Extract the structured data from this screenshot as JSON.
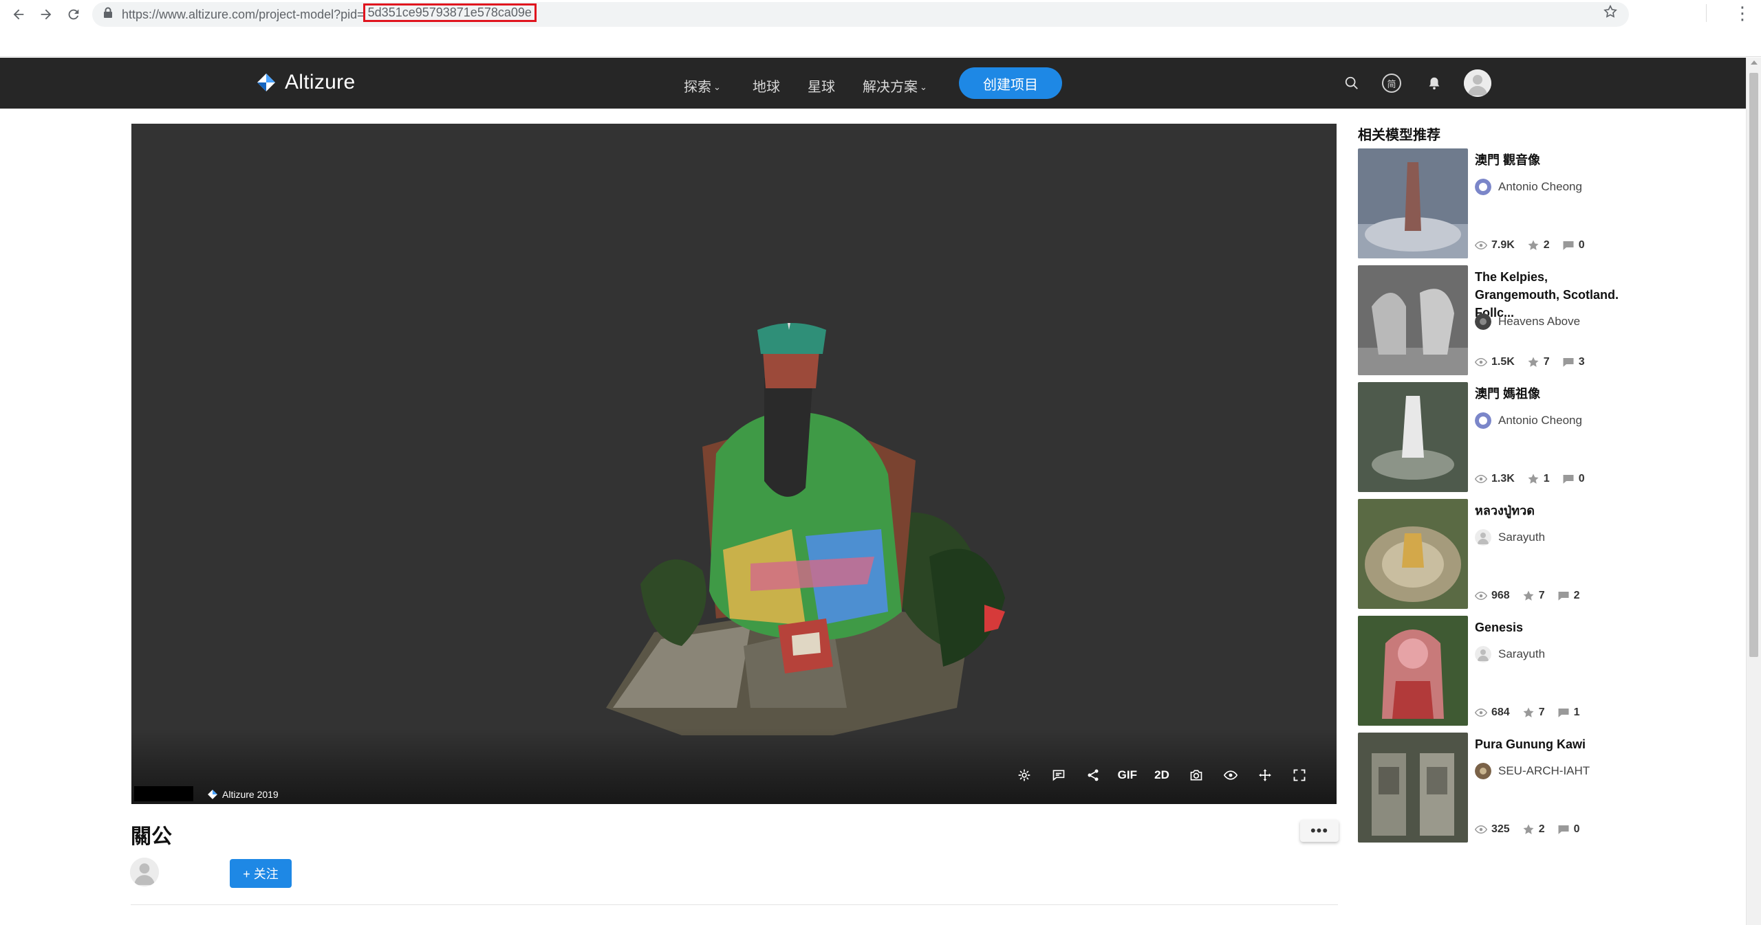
{
  "browser": {
    "url_prefix": "https://www.altizure.com/project-model?pid=",
    "url_host": "www.altizure.com",
    "url_pid": "5d351ce95793871e578ca09e"
  },
  "header": {
    "brand": "Altizure",
    "nav": [
      {
        "label": "探索",
        "has_caret": true
      },
      {
        "label": "地球",
        "has_caret": false
      },
      {
        "label": "星球",
        "has_caret": false
      },
      {
        "label": "解决方案",
        "has_caret": true
      }
    ],
    "create_button": "创建项目",
    "lang_badge": "简",
    "caret_glyph": "⌄"
  },
  "viewer": {
    "toolbar_gif": "GIF",
    "toolbar_2d": "2D",
    "credit": "Altizure 2019"
  },
  "project": {
    "title": "關公",
    "more_label": "•••",
    "follow_label": "+ 关注"
  },
  "sidebar": {
    "title": "相关模型推荐",
    "items": [
      {
        "title": "澳門 觀音像",
        "author": "Antonio Cheong",
        "views": "7.9K",
        "stars": "2",
        "comments": "0"
      },
      {
        "title": "The Kelpies, Grangemouth, Scotland. Follc...",
        "author": "Heavens Above",
        "views": "1.5K",
        "stars": "7",
        "comments": "3"
      },
      {
        "title": "澳門 媽祖像",
        "author": "Antonio Cheong",
        "views": "1.3K",
        "stars": "1",
        "comments": "0"
      },
      {
        "title": "หลวงปู่ทวด",
        "author": "Sarayuth",
        "views": "968",
        "stars": "7",
        "comments": "2"
      },
      {
        "title": "Genesis",
        "author": "Sarayuth",
        "views": "684",
        "stars": "7",
        "comments": "1"
      },
      {
        "title": "Pura Gunung Kawi",
        "author": "SEU-ARCH-IAHT",
        "views": "325",
        "stars": "2",
        "comments": "0"
      }
    ]
  },
  "colors": {
    "header_bg": "#262626",
    "accent": "#1e88e5",
    "viewer_bg": "#333333",
    "url_highlight": "#e0141e"
  }
}
